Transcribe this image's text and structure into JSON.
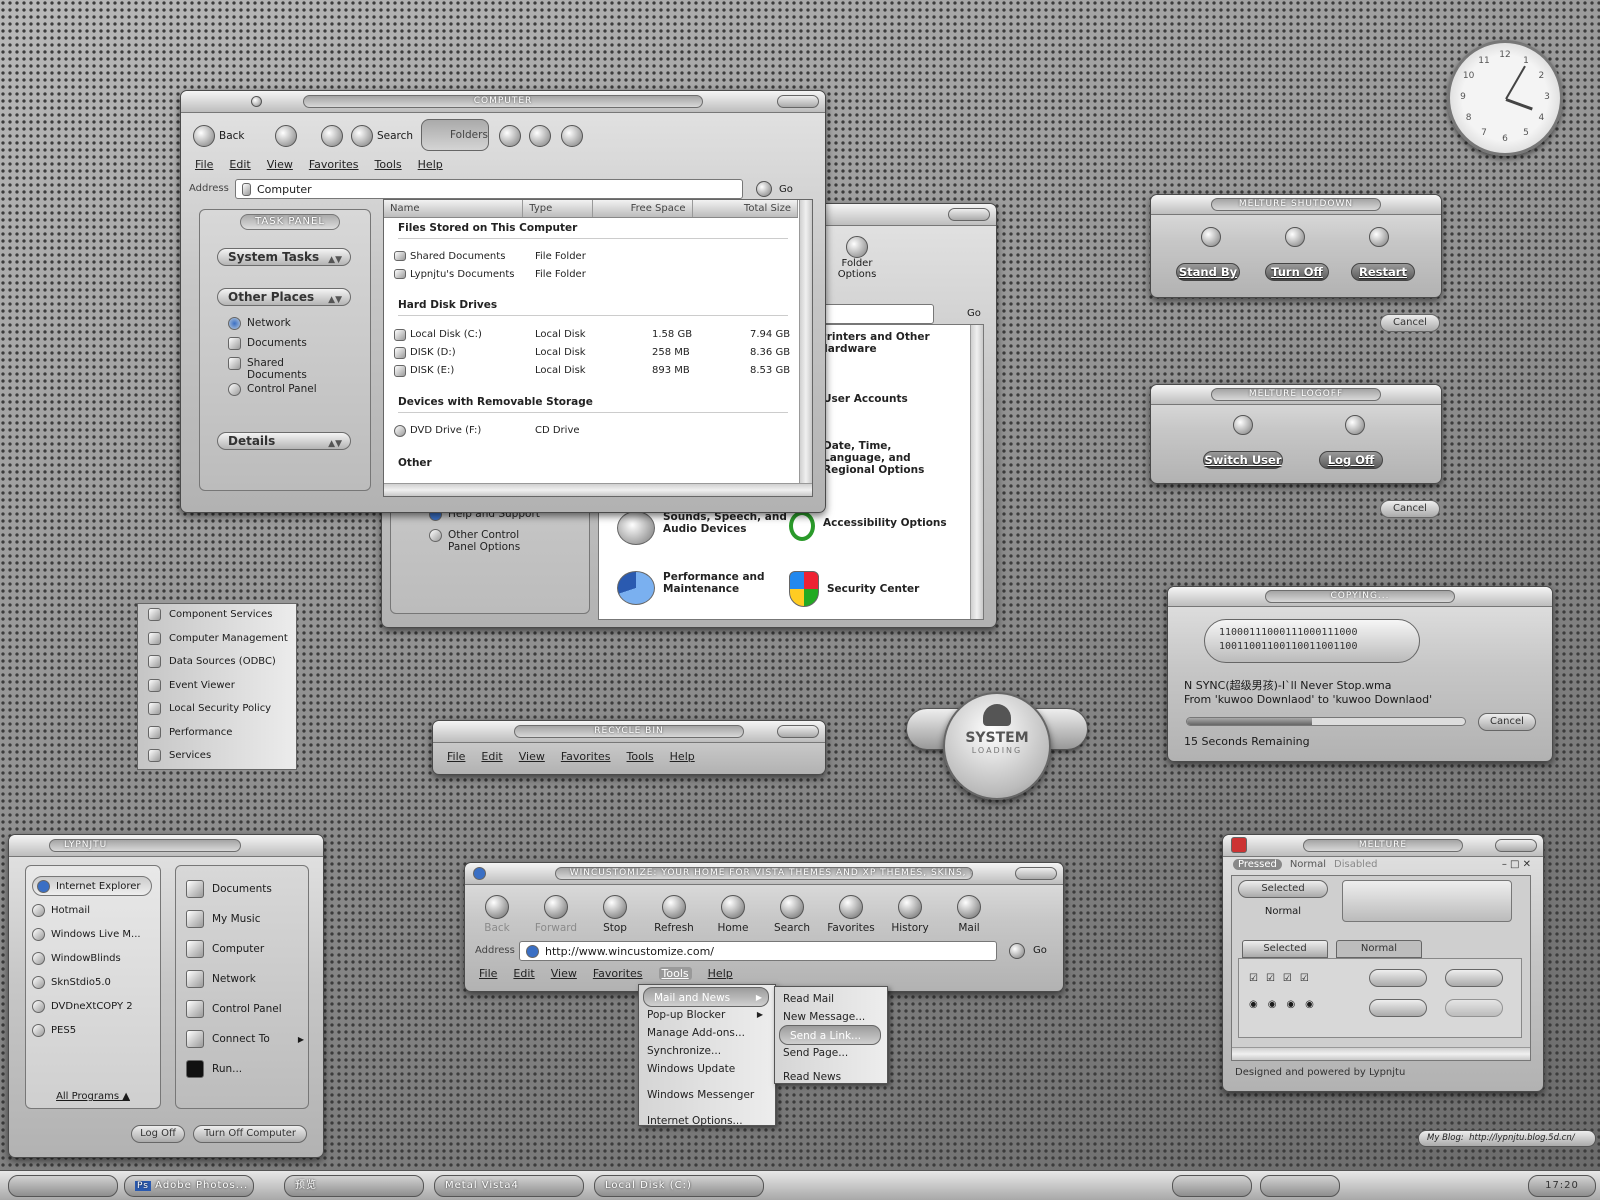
{
  "computer_window": {
    "title": "Computer",
    "toolbar": {
      "back": "Back",
      "search": "Search",
      "folders": "Folders"
    },
    "menu": [
      "File",
      "Edit",
      "View",
      "Favorites",
      "Tools",
      "Help"
    ],
    "address_label": "Address",
    "address_value": "Computer",
    "go": "Go",
    "task_panel": {
      "title": "Task Panel",
      "system_tasks": "System Tasks",
      "other_places": "Other Places",
      "places": [
        "Network",
        "Documents",
        "Shared Documents",
        "Control Panel"
      ],
      "details": "Details"
    },
    "columns": [
      "Name",
      "Type",
      "Free Space",
      "Total Size"
    ],
    "groups": {
      "stored": "Files Stored on This Computer",
      "hdd": "Hard Disk Drives",
      "removable": "Devices with Removable Storage",
      "other": "Other"
    },
    "stored_rows": [
      {
        "name": "Shared Documents",
        "type": "File Folder"
      },
      {
        "name": "Lypnjtu's Documents",
        "type": "File Folder"
      }
    ],
    "disk_rows": [
      {
        "name": "Local Disk (C:)",
        "type": "Local Disk",
        "free": "1.58 GB",
        "total": "7.94 GB"
      },
      {
        "name": "DISK (D:)",
        "type": "Local Disk",
        "free": "258 MB",
        "total": "8.36 GB"
      },
      {
        "name": "DISK (E:)",
        "type": "Local Disk",
        "free": "893 MB",
        "total": "8.53 GB"
      }
    ],
    "removable_rows": [
      {
        "name": "DVD Drive (F:)",
        "type": "CD Drive"
      }
    ]
  },
  "control_panel": {
    "go": "Go",
    "folder_options": "Folder Options",
    "left_links": [
      "Help and Support",
      "Other Control Panel Options"
    ],
    "items": [
      "Printers and Other Hardware",
      "User Accounts",
      "Date, Time, Language, and Regional Options",
      "Sounds, Speech, and Audio Devices",
      "Accessibility Options",
      "Performance and Maintenance",
      "Security Center"
    ]
  },
  "admin_menu": [
    "Component Services",
    "Computer Management",
    "Data Sources (ODBC)",
    "Event Viewer",
    "Local Security Policy",
    "Performance",
    "Services"
  ],
  "recycle_bin": {
    "title": "Recycle Bin",
    "menu": [
      "File",
      "Edit",
      "View",
      "Favorites",
      "Tools",
      "Help"
    ]
  },
  "system_loading": {
    "line1": "SYSTEM",
    "line2": "LOADING"
  },
  "shutdown_dialog": {
    "title": "Melture Shutdown",
    "buttons": [
      "Stand By",
      "Turn Off",
      "Restart"
    ],
    "cancel": "Cancel"
  },
  "logoff_dialog": {
    "title": "Melture Logoff",
    "buttons": [
      "Switch User",
      "Log Off"
    ],
    "cancel": "Cancel"
  },
  "copy_dialog": {
    "title": "Copying...",
    "binary_1": "11000111000111000111000",
    "binary_2": "10011001100110011001100",
    "file": "N SYNC(超级男孩)-I`ll Never Stop.wma",
    "from_to": "From 'kuwoo Downlaod' to 'kuwoo Downlaod'",
    "remaining": "15 Seconds Remaining",
    "progress_percent": 45,
    "cancel": "Cancel"
  },
  "start_menu": {
    "user": "Lypnjtu",
    "left_items": [
      "Internet Explorer",
      "Hotmail",
      "Windows Live M...",
      "WindowBlinds",
      "SknStdio5.0",
      "DVDneXtCOPY 2",
      "PES5"
    ],
    "all_programs": "All Programs",
    "right_items": [
      "Documents",
      "My Music",
      "Computer",
      "Network",
      "Control Panel",
      "Connect To",
      "Run..."
    ],
    "log_off": "Log Off",
    "turn_off": "Turn Off Computer"
  },
  "ie_window": {
    "title": "WinCustomize: Your home for Vista themes and XP themes, skins, wal...",
    "toolbar": [
      "Back",
      "Forward",
      "Stop",
      "Refresh",
      "Home",
      "Search",
      "Favorites",
      "History",
      "Mail"
    ],
    "address_label": "Address",
    "address_value": "http://www.wincustomize.com/",
    "go": "Go",
    "menu": [
      "File",
      "Edit",
      "View",
      "Favorites",
      "Tools",
      "Help"
    ],
    "tools_menu": [
      "Mail and News",
      "Pop-up Blocker",
      "Manage Add-ons...",
      "Synchronize...",
      "Windows Update",
      "Windows Messenger",
      "Internet Options..."
    ],
    "mail_submenu": [
      "Read Mail",
      "New Message...",
      "Send a Link...",
      "Send Page...",
      "Read News"
    ]
  },
  "melture_window": {
    "title": "Melture",
    "tabs": [
      "Pressed",
      "Normal",
      "Disabled"
    ],
    "button_states": [
      "Selected",
      "Normal"
    ],
    "tab_states": [
      "Selected",
      "Normal"
    ],
    "footer": "Designed and powered by Lypnjtu"
  },
  "clock": {
    "numbers": [
      "12",
      "1",
      "2",
      "3",
      "4",
      "5",
      "6",
      "7",
      "8",
      "9",
      "10",
      "11"
    ]
  },
  "blog_bar": {
    "label": "My Blog:",
    "url": "http://lypnjtu.blog.5d.cn/"
  },
  "taskbar": {
    "items": [
      "Adobe Photos...",
      "预览",
      "Metal Vista4",
      "Local Disk (C:)"
    ],
    "time": "17:20",
    "ps_badge": "Ps"
  },
  "colors": {
    "accent_blue": "#3a6fc4",
    "metal_light": "#e4e4e4",
    "metal_dark": "#6a6a6a"
  }
}
